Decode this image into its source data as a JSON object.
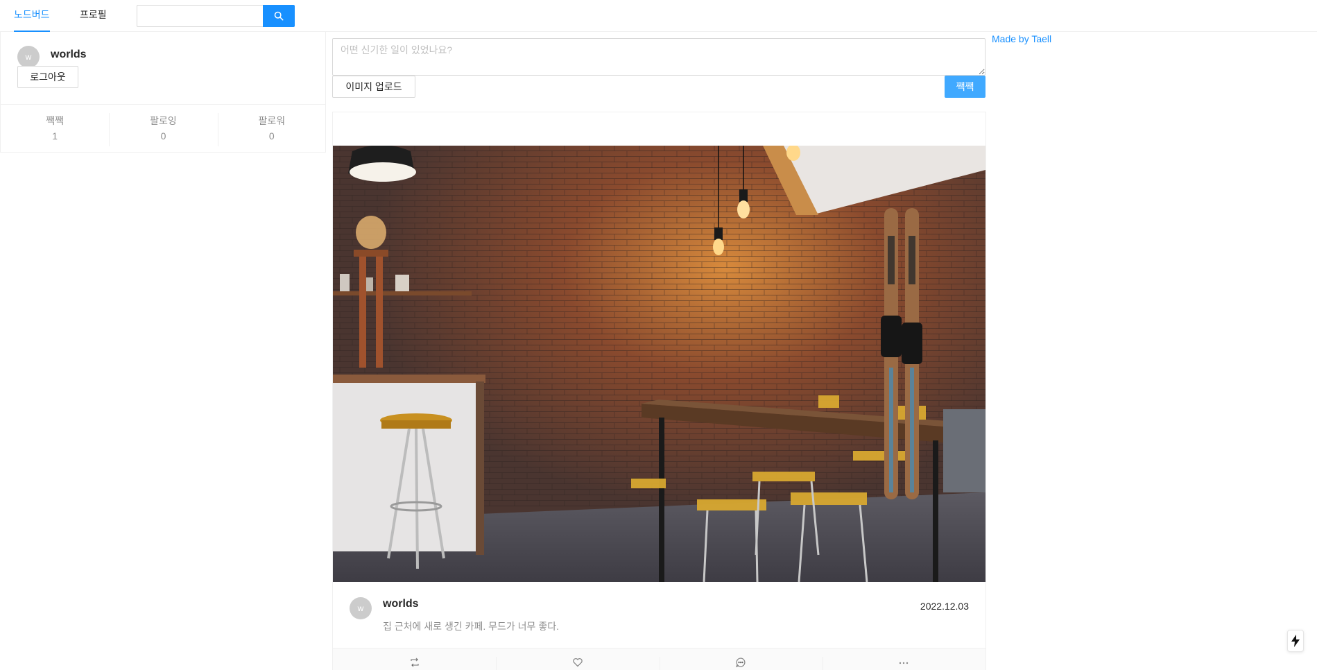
{
  "header": {
    "menu": [
      {
        "label": "노드버드",
        "active": true
      },
      {
        "label": "프로필",
        "active": false
      }
    ],
    "search": {
      "value": "",
      "placeholder": ""
    }
  },
  "profile": {
    "avatar_initial": "w",
    "name": "worlds",
    "logout_label": "로그아웃",
    "stats": [
      {
        "label": "짹짹",
        "value": "1"
      },
      {
        "label": "팔로잉",
        "value": "0"
      },
      {
        "label": "팔로워",
        "value": "0"
      }
    ]
  },
  "post_form": {
    "placeholder": "어떤 신기한 일이 있었나요?",
    "upload_label": "이미지 업로드",
    "submit_label": "짹짹"
  },
  "side": {
    "made_by": "Made by Taell"
  },
  "post": {
    "avatar_initial": "w",
    "author": "worlds",
    "date": "2022.12.03",
    "content": "집 근처에 새로 생긴 카페. 무드가 너무 좋다.",
    "image_desc": "cafe-interior-photo",
    "actions": [
      "retweet-icon",
      "heart-icon",
      "message-icon",
      "ellipsis-icon"
    ]
  },
  "colors": {
    "primary": "#1890ff",
    "submit": "#40a9ff",
    "avatar_bg": "#cccccc",
    "border": "#f0f0f0"
  }
}
